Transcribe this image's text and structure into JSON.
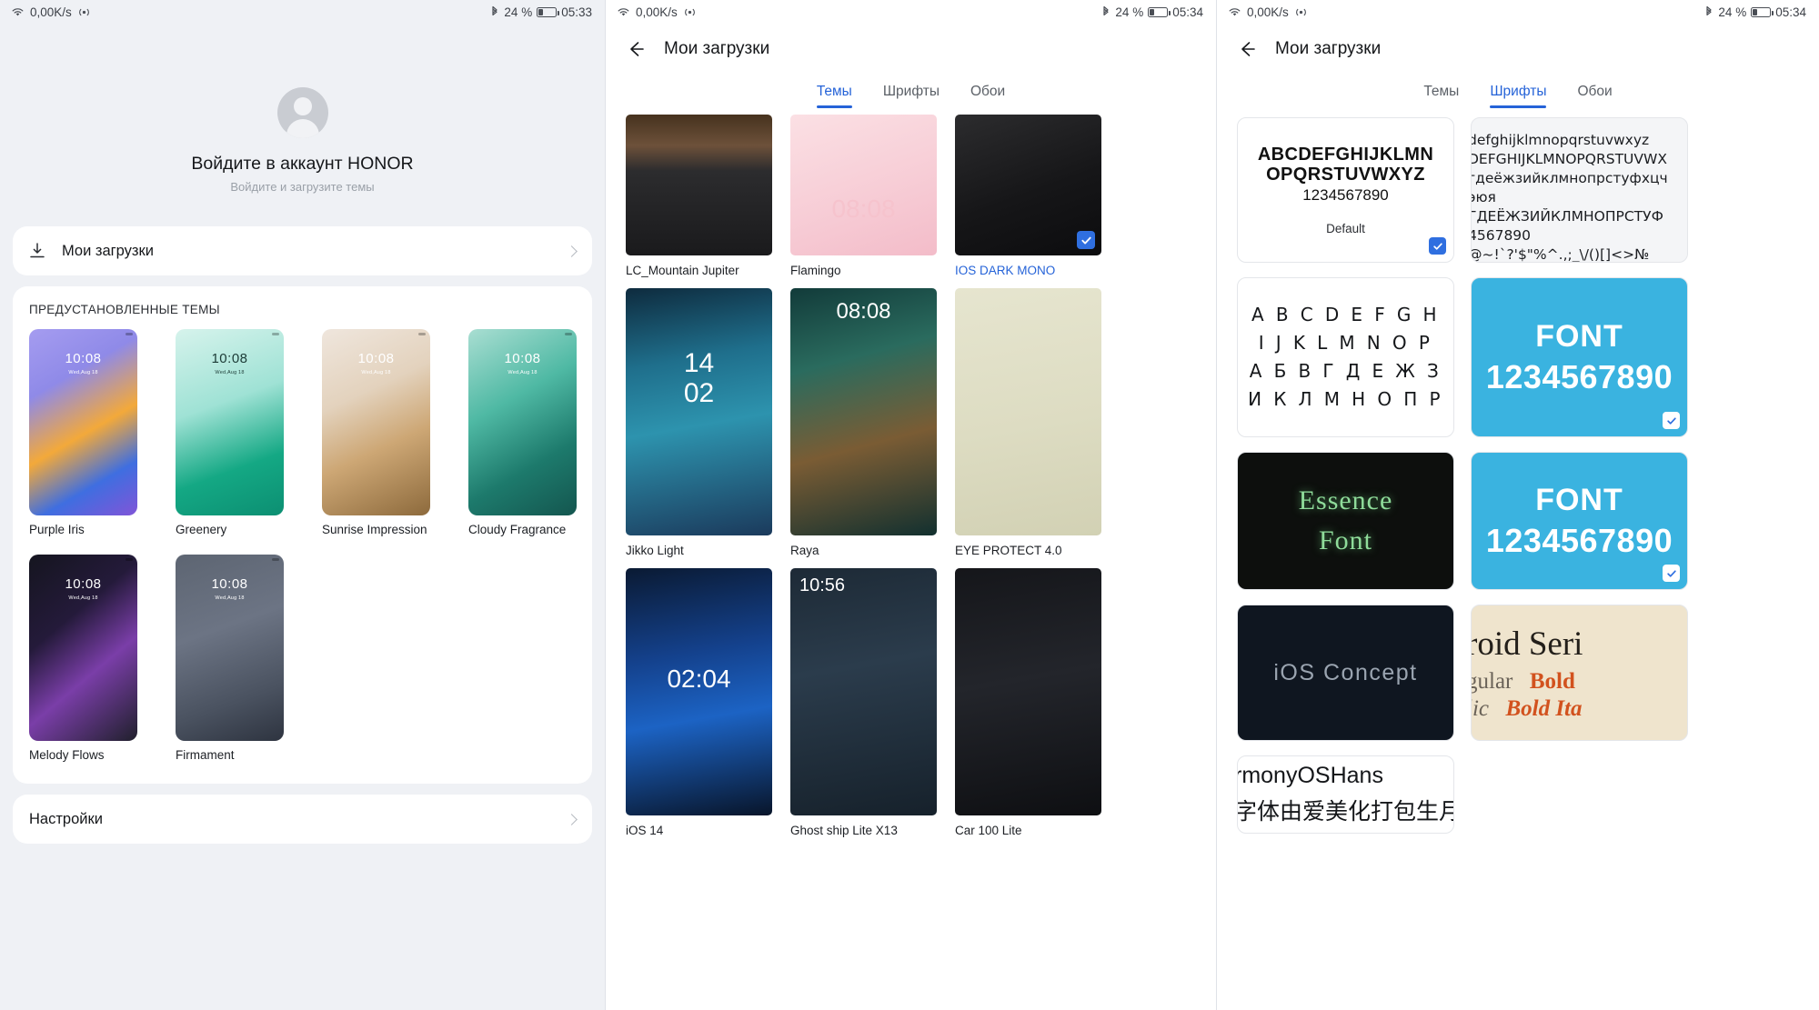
{
  "status_bar": {
    "network_speed": "0,00K/s",
    "battery_percent": "24 %",
    "time_left": "05:33",
    "time_right": "05:34"
  },
  "panel_account": {
    "title": "Войдите в аккаунт HONOR",
    "subtitle": "Войдите и загрузите темы",
    "downloads_label": "Мои загрузки",
    "settings_label": "Настройки",
    "section_title": "ПРЕДУСТАНОВЛЕННЫЕ ТЕМЫ",
    "preview_time": "10:08",
    "preview_date": "Wed,Aug 18",
    "themes": [
      {
        "name": "Purple Iris",
        "time_color": "#ffffff"
      },
      {
        "name": "Greenery",
        "time_color": "#1c3b36"
      },
      {
        "name": "Sunrise Impression",
        "time_color": "#ffffff"
      },
      {
        "name": "Cloudy Fragrance",
        "time_color": "#ffffff"
      },
      {
        "name": "Melody Flows",
        "time_color": "#ffffff"
      },
      {
        "name": "Firmament",
        "time_color": "#ffffff"
      }
    ]
  },
  "panel_downloads_themes": {
    "header_title": "Мои загрузки",
    "tabs": [
      {
        "label": "Темы",
        "active": true
      },
      {
        "label": "Шрифты",
        "active": false
      },
      {
        "label": "Обои",
        "active": false
      }
    ],
    "items": [
      {
        "name": "LC_Mountain Jupiter",
        "selected": false
      },
      {
        "name": "Flamingo",
        "selected": false,
        "overlay_time": "08:08"
      },
      {
        "name": "IOS DARK MONO",
        "selected": true
      },
      {
        "name": "Jikko Light",
        "selected": false,
        "overlay_time": "14\n02"
      },
      {
        "name": "Raya",
        "selected": false,
        "overlay_time": "08:08"
      },
      {
        "name": "EYE PROTECT 4.0",
        "selected": false
      },
      {
        "name": "iOS 14",
        "selected": false,
        "overlay_time": "02:04"
      },
      {
        "name": "Ghost ship Lite X13",
        "selected": false,
        "overlay_time": "10:56"
      },
      {
        "name": "Car 100 Lite",
        "selected": false
      }
    ]
  },
  "panel_downloads_fonts": {
    "header_title": "Мои загрузки",
    "tabs": [
      {
        "label": "Темы",
        "active": false
      },
      {
        "label": "Шрифты",
        "active": true
      },
      {
        "label": "Обои",
        "active": false
      }
    ],
    "cards": [
      {
        "id": "default",
        "line1": "ABCDEFGHIJKLMN",
        "line2": "OPQRSTUVWXYZ",
        "line3": "1234567890",
        "name": "Default",
        "selected": true
      },
      {
        "id": "cyrillic-sample",
        "lines": [
          "defghijklmnopqrstuvwxyz",
          "DEFGHIJKLMNOPQRSTUVWX",
          "гдеёжзийклмнопрстуфхцч",
          "эюя",
          "ГДЕЁЖЗИЙКЛМНОПРСТУФ",
          "4567890",
          "@~!`?'$\"%^.,;_\\/()[]<>№"
        ],
        "selected": false
      },
      {
        "id": "abc-wide",
        "lines": [
          "A B C D E F G H",
          "I J K L M N O P",
          "А Б В Г Д Е Ж З",
          "И К Л М Н О П Р"
        ],
        "selected": false
      },
      {
        "id": "font-blue-1",
        "line1": "FONT",
        "line2": "1234567890",
        "selected": true
      },
      {
        "id": "essence-font",
        "line1": "Essence",
        "line2": "Font",
        "selected": false
      },
      {
        "id": "font-blue-2",
        "line1": "FONT",
        "line2": "1234567890",
        "selected": true
      },
      {
        "id": "ios-concept",
        "line1": "iOS Concept",
        "selected": false
      },
      {
        "id": "droid-serif",
        "line1": "roid Seri",
        "seg1": "gular",
        "seg2": "Bold",
        "seg3": "lic",
        "seg4": "Bold Ita",
        "selected": false
      },
      {
        "id": "harmony-os-hans",
        "line1": "rmonyOSHans",
        "line2": "字体由爱美化打包生月",
        "selected": false
      }
    ]
  },
  "colors": {
    "accent": "#2563d8",
    "tick": "#2f6fe0",
    "page_bg": "#eff1f5",
    "card_bg": "#ffffff"
  },
  "icons": {
    "wifi": "wifi-icon",
    "bluetooth": "bluetooth-icon",
    "battery": "battery-icon",
    "download": "download-icon",
    "back": "back-arrow-icon",
    "chevron": "chevron-right-icon",
    "check": "check-icon"
  }
}
